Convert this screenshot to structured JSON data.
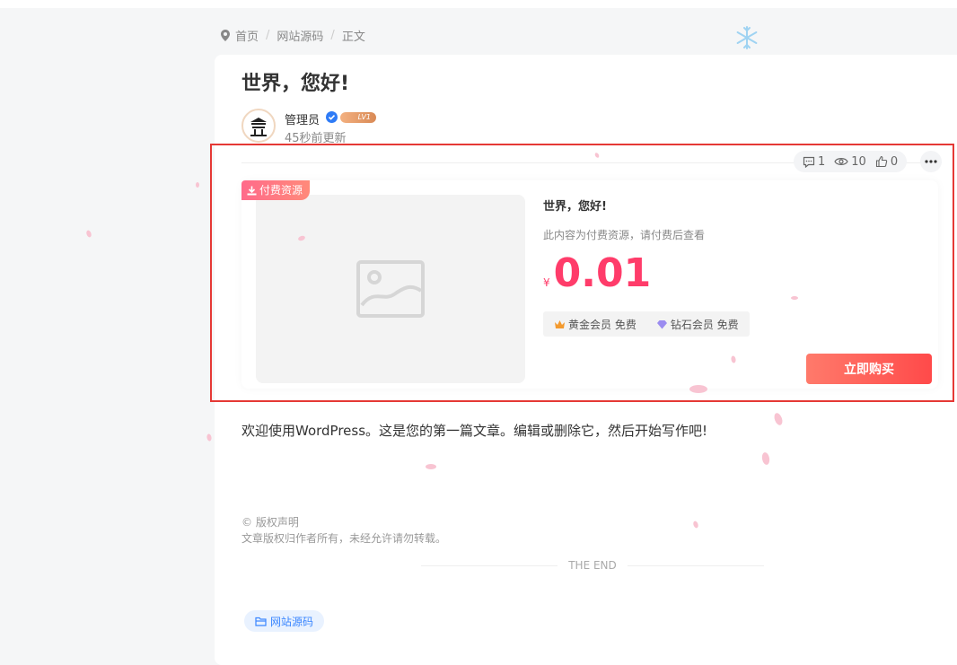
{
  "breadcrumb": {
    "home": "首页",
    "category": "网站源码",
    "current": "正文"
  },
  "post": {
    "title": "世界，您好!",
    "author": "管理员",
    "level": "LV1",
    "update_time": "45秒前更新",
    "stats": {
      "comments": "1",
      "views": "10",
      "likes": "0"
    },
    "content": "欢迎使用WordPress。这是您的第一篇文章。编辑或删除它，然后开始写作吧!"
  },
  "pay": {
    "tag": "付费资源",
    "title": "世界，您好!",
    "desc": "此内容为付费资源，请付费后查看",
    "currency": "¥",
    "price": "0.01",
    "gold_vip": "黄金会员 免费",
    "diamond_vip": "钻石会员 免费",
    "buy_label": "立即购买"
  },
  "copyright": {
    "title": "© 版权声明",
    "text": "文章版权归作者所有，未经允许请勿转载。"
  },
  "end_text": "THE END",
  "tag_label": "网站源码",
  "colors": {
    "accent": "#ff3c6a",
    "buy": "#ff4a4a",
    "tag": "#3a86ff",
    "highlight": "#e53935"
  }
}
